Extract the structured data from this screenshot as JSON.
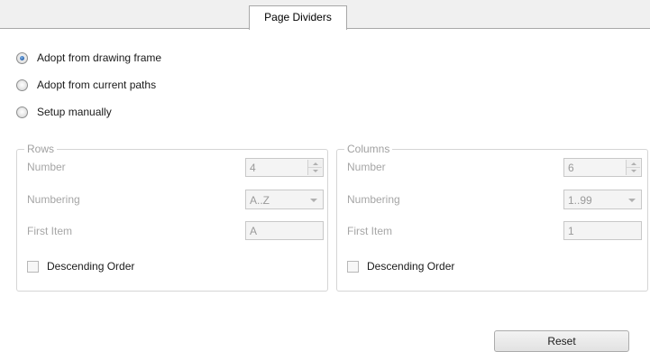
{
  "tabs": [
    {
      "label": "Page Dividers",
      "active": true
    }
  ],
  "source_options": [
    {
      "label": "Adopt from drawing frame",
      "checked": true
    },
    {
      "label": "Adopt from current paths",
      "checked": false
    },
    {
      "label": "Setup manually",
      "checked": false
    }
  ],
  "rows_group": {
    "title": "Rows",
    "number_label": "Number",
    "number_value": "4",
    "numbering_label": "Numbering",
    "numbering_value": "A..Z",
    "first_item_label": "First Item",
    "first_item_value": "A",
    "descending_label": "Descending Order",
    "descending_checked": false
  },
  "columns_group": {
    "title": "Columns",
    "number_label": "Number",
    "number_value": "6",
    "numbering_label": "Numbering",
    "numbering_value": "1..99",
    "first_item_label": "First Item",
    "first_item_value": "1",
    "descending_label": "Descending Order",
    "descending_checked": false
  },
  "reset_label": "Reset",
  "colors": {
    "radio_selected": "#2a62a8",
    "disabled_text": "#a6a6a6"
  }
}
